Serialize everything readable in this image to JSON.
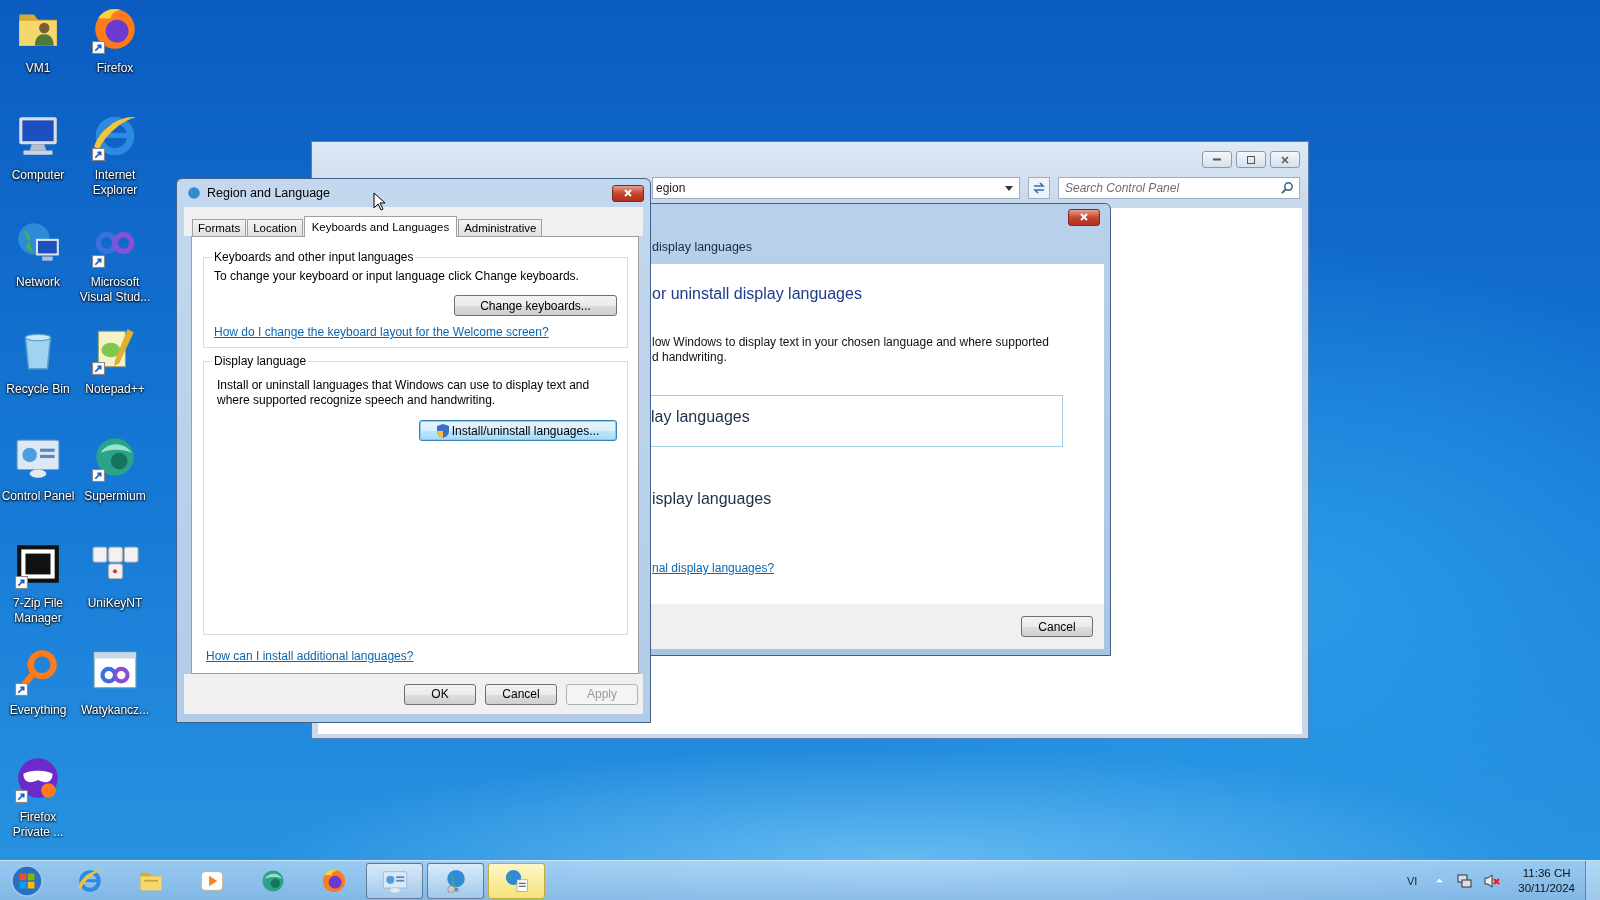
{
  "desktop_icons": [
    {
      "label": "VM1",
      "kind": "folder",
      "shortcut": false
    },
    {
      "label": "Firefox",
      "kind": "firefox",
      "shortcut": true
    },
    {
      "label": "Computer",
      "kind": "computer",
      "shortcut": false
    },
    {
      "label": "Internet Explorer",
      "kind": "ie",
      "shortcut": true
    },
    {
      "label": "Network",
      "kind": "network",
      "shortcut": false
    },
    {
      "label": "Microsoft Visual Stud...",
      "kind": "vs",
      "shortcut": true
    },
    {
      "label": "Recycle Bin",
      "kind": "recycle",
      "shortcut": false
    },
    {
      "label": "Notepad++",
      "kind": "notepad",
      "shortcut": true
    },
    {
      "label": "Control Panel",
      "kind": "controlpanel",
      "shortcut": false
    },
    {
      "label": "Supermium",
      "kind": "supermium",
      "shortcut": true
    },
    {
      "label": "7-Zip File Manager",
      "kind": "sevenzip",
      "shortcut": true
    },
    {
      "label": "UniKeyNT",
      "kind": "unikey",
      "shortcut": false
    },
    {
      "label": "Everything",
      "kind": "everything",
      "shortcut": true
    },
    {
      "label": "Watykancz...",
      "kind": "watykancz",
      "shortcut": false
    },
    {
      "label": "Firefox Private ...",
      "kind": "ffprivate",
      "shortcut": true
    }
  ],
  "control_panel_window": {
    "address": "egion",
    "search": {
      "placeholder": "Search Control Panel"
    }
  },
  "install_dialog": {
    "header": "display languages",
    "title": "or uninstall display languages",
    "description": [
      "low Windows to display text in your chosen language and where supported",
      "d handwriting."
    ],
    "options": [
      {
        "label": "lay languages",
        "selected": true
      },
      {
        "label": "isplay languages",
        "selected": false
      }
    ],
    "link": "nal display languages?",
    "buttons": [
      "Cancel"
    ]
  },
  "region_dialog": {
    "title": "Region and Language",
    "tabs": [
      {
        "label": "Formats",
        "selected": false
      },
      {
        "label": "Location",
        "selected": false
      },
      {
        "label": "Keyboards and Languages",
        "selected": true
      },
      {
        "label": "Administrative",
        "selected": false
      }
    ],
    "keyboards_group": {
      "legend": "Keyboards and other input languages",
      "text": "To change your keyboard or input language click Change keyboards.",
      "button": "Change keyboards...",
      "link": "How do I change the keyboard layout for the Welcome screen?"
    },
    "display_group": {
      "legend": "Display language",
      "text": "Install or uninstall languages that Windows can use to display text and where supported recognize speech and handwriting.",
      "button": "Install/uninstall languages..."
    },
    "link": "How can I install additional languages?",
    "buttons": [
      {
        "label": "OK",
        "disabled": false
      },
      {
        "label": "Cancel",
        "disabled": false
      },
      {
        "label": "Apply",
        "disabled": true
      }
    ]
  },
  "taskbar": {
    "apps": [
      {
        "kind": "ie",
        "open": false,
        "selected": false
      },
      {
        "kind": "explorer",
        "open": false,
        "selected": false
      },
      {
        "kind": "media",
        "open": false,
        "selected": false
      },
      {
        "kind": "supermium",
        "open": false,
        "selected": false
      },
      {
        "kind": "firefox",
        "open": false,
        "selected": false
      },
      {
        "kind": "controlpanel",
        "open": true,
        "selected": false
      },
      {
        "kind": "netglobe",
        "open": true,
        "selected": false
      },
      {
        "kind": "region",
        "open": true,
        "selected": true
      }
    ],
    "language": "VI",
    "time": "11:36 CH",
    "date": "30/11/2024"
  }
}
